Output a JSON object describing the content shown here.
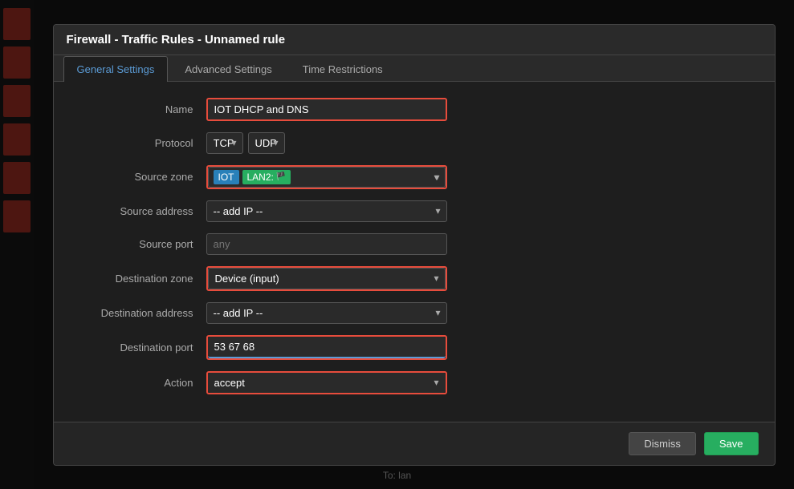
{
  "dialog": {
    "title": "Firewall - Traffic Rules - Unnamed rule",
    "tabs": [
      {
        "id": "general",
        "label": "General Settings",
        "active": true
      },
      {
        "id": "advanced",
        "label": "Advanced Settings",
        "active": false
      },
      {
        "id": "time",
        "label": "Time Restrictions",
        "active": false
      }
    ],
    "fields": {
      "name_label": "Name",
      "name_value": "IOT DHCP and DNS",
      "name_placeholder": "",
      "protocol_label": "Protocol",
      "protocol_value1": "TCP",
      "protocol_value2": "UDP",
      "source_zone_label": "Source zone",
      "source_zone_tag1": "IOT",
      "source_zone_tag2": "LAN2:",
      "source_address_label": "Source address",
      "source_address_placeholder": "-- add IP --",
      "source_port_label": "Source port",
      "source_port_placeholder": "any",
      "dest_zone_label": "Destination zone",
      "dest_zone_value": "Device (input)",
      "dest_address_label": "Destination address",
      "dest_address_placeholder": "-- add IP --",
      "dest_port_label": "Destination port",
      "dest_port_value": "53 67 68",
      "action_label": "Action",
      "action_value": "accept"
    },
    "footer": {
      "dismiss_label": "Dismiss",
      "save_label": "Save"
    }
  },
  "bottom_label": "To: lan"
}
